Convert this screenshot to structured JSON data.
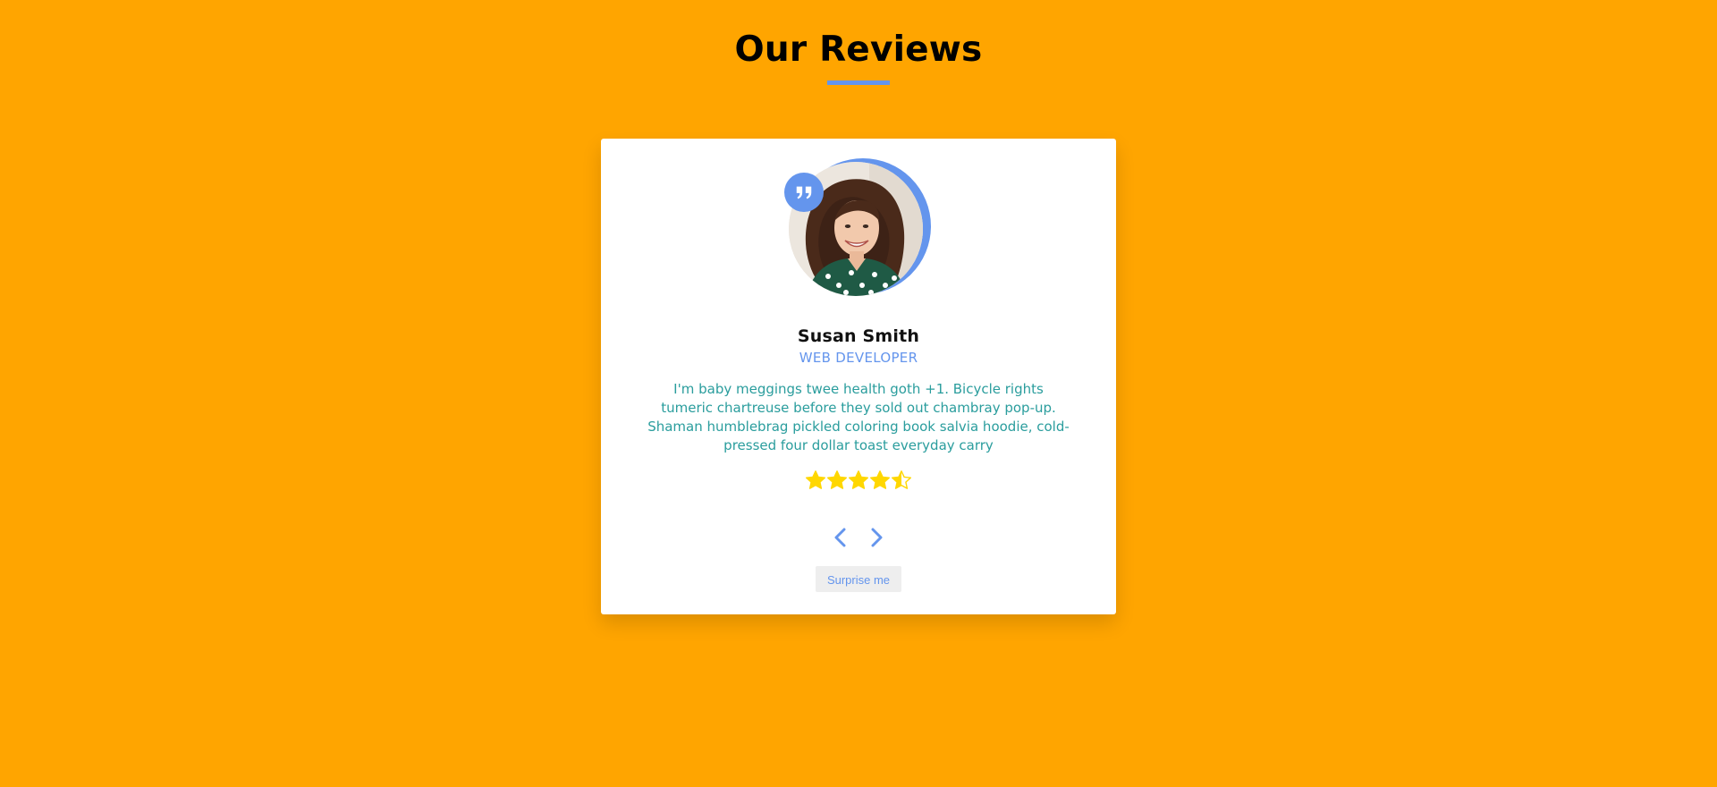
{
  "header": {
    "title": "Our Reviews"
  },
  "review": {
    "name": "Susan Smith",
    "job": "WEB DEVELOPER",
    "text": "I'm baby meggings twee health goth +1. Bicycle rights tumeric chartreuse before they sold out chambray pop-up. Shaman humblebrag pickled coloring book salvia hoodie, cold-pressed four dollar toast everyday carry",
    "rating": 4.5,
    "rating_max": 5
  },
  "controls": {
    "prev_icon": "chevron-left-icon",
    "next_icon": "chevron-right-icon",
    "surprise_label": "Surprise me"
  },
  "colors": {
    "page_background": "#ffa500",
    "accent": "#6495ed",
    "text_teal": "#2a9d9d",
    "star": "#ffd700",
    "card": "#ffffff"
  },
  "icons": {
    "quote": "quote-icon",
    "star": "star-icon"
  }
}
